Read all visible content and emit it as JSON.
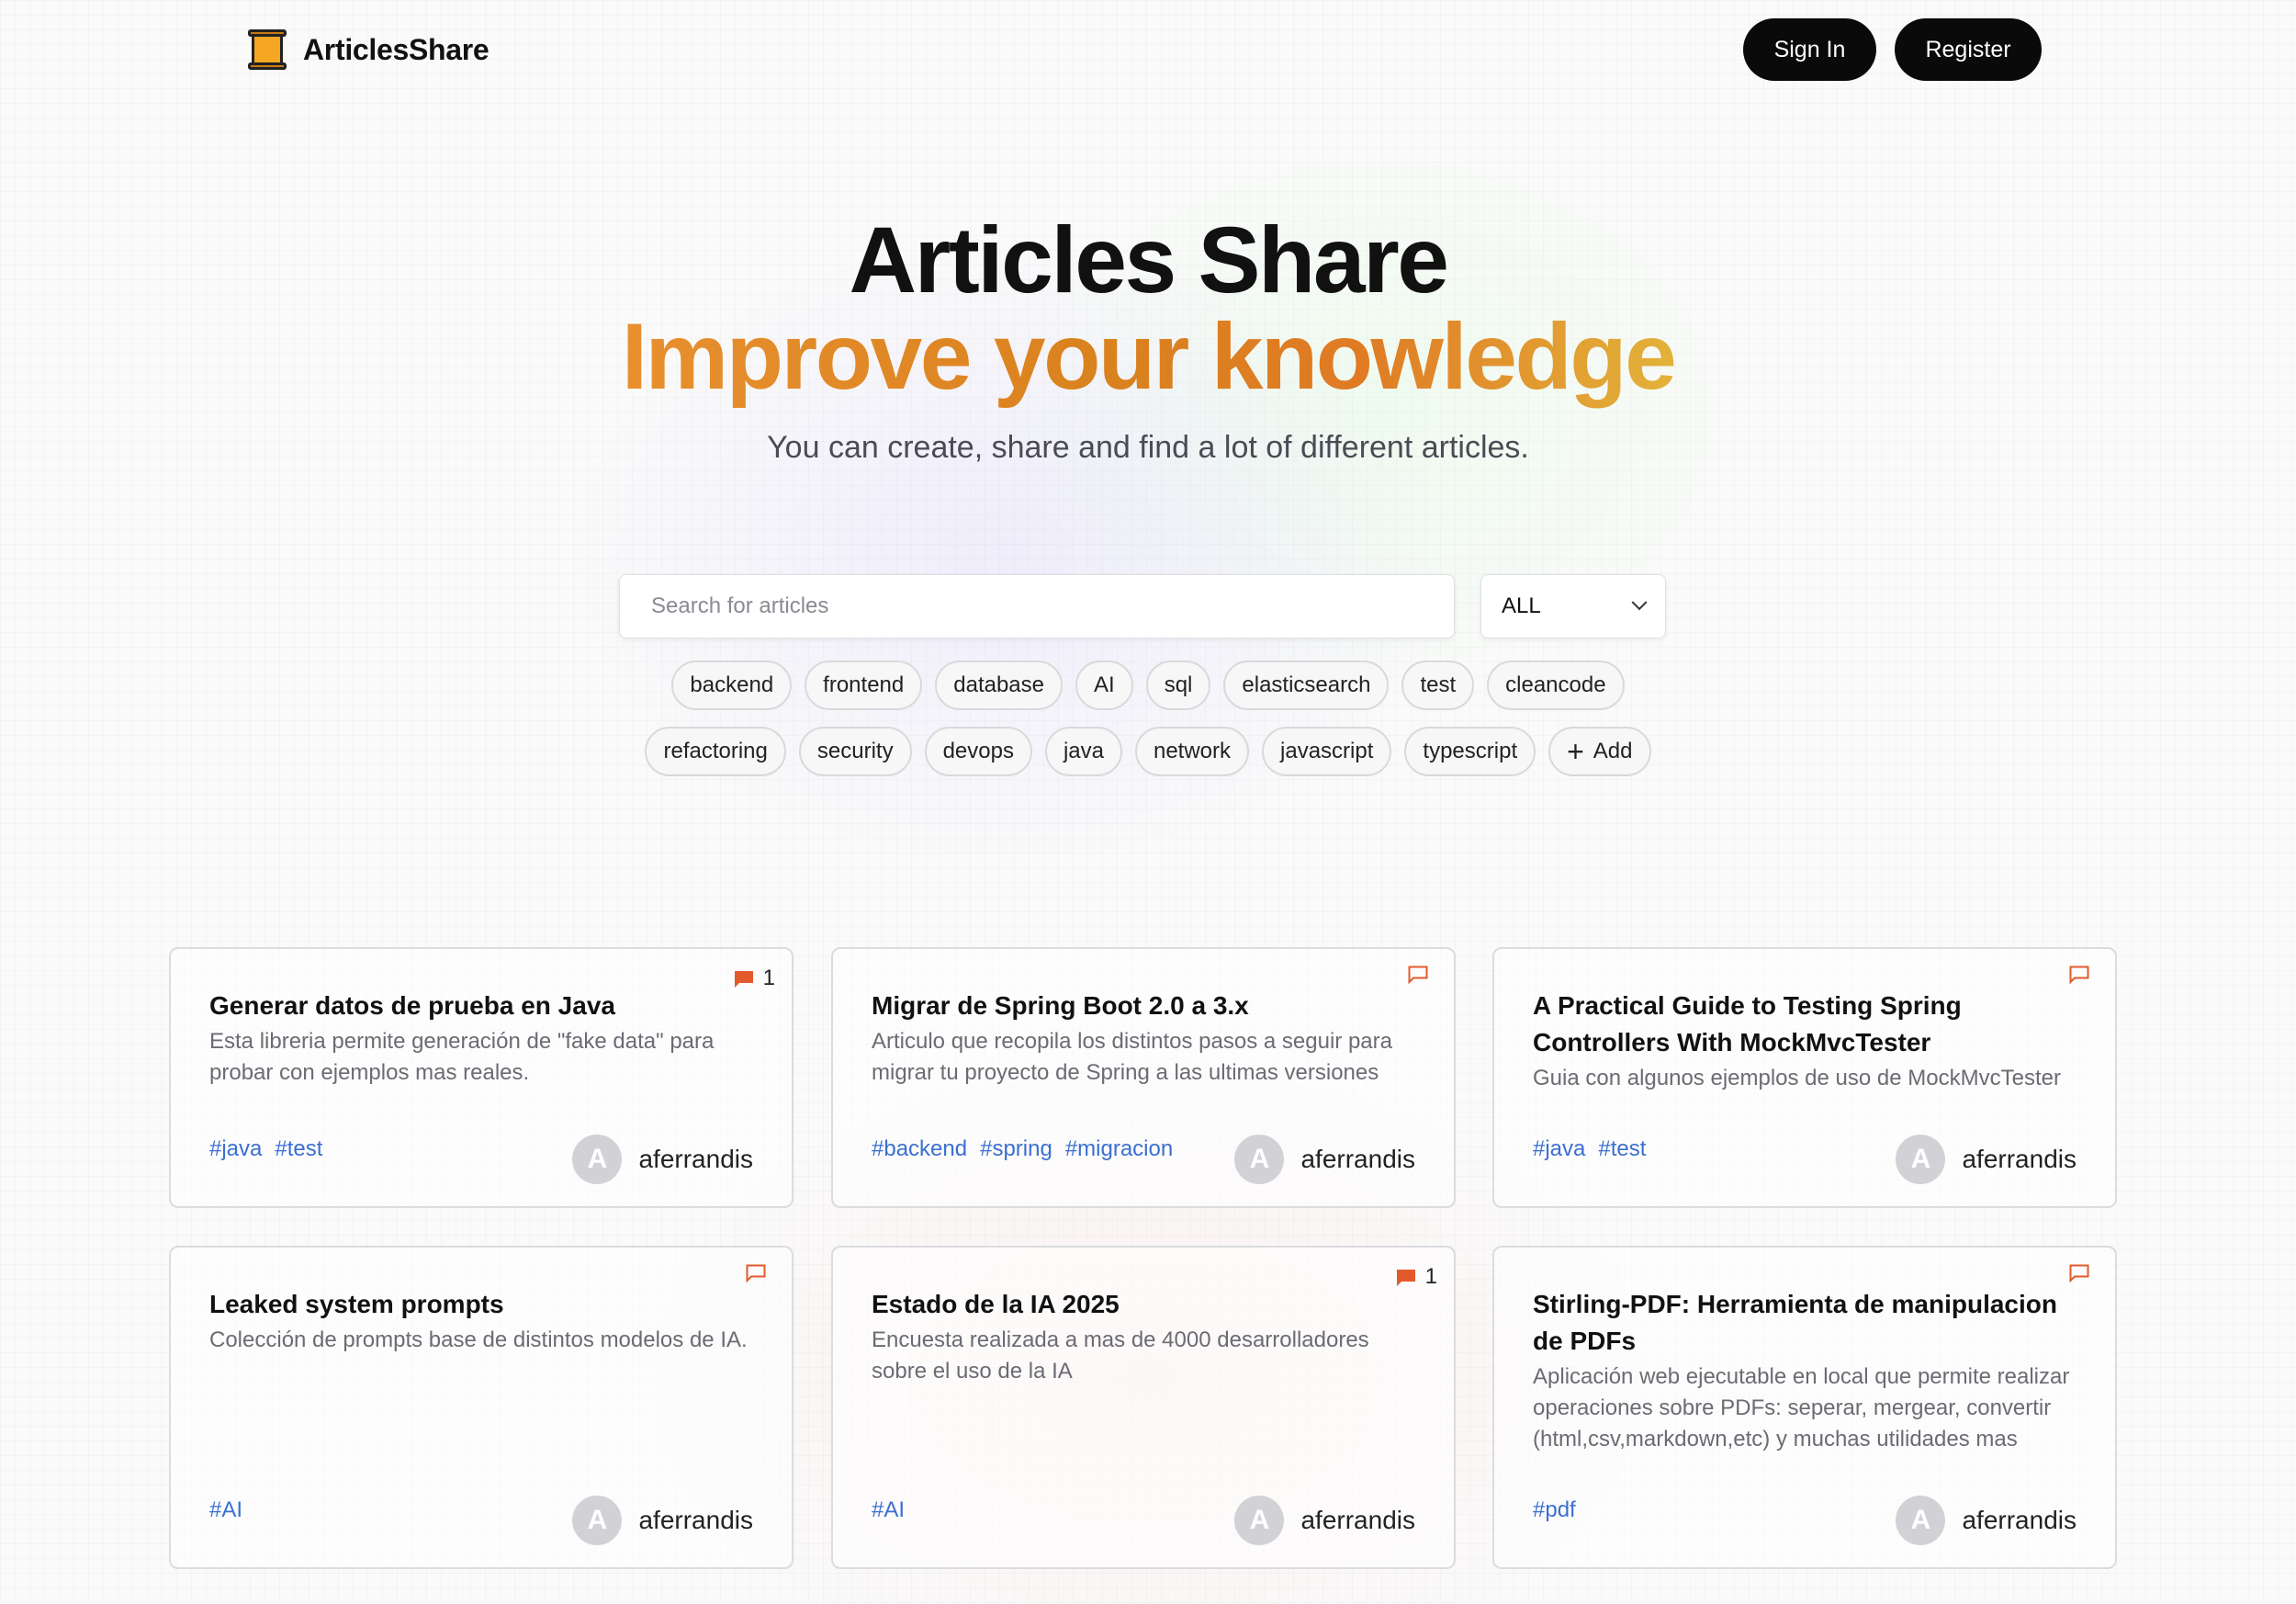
{
  "header": {
    "brand": "ArticlesShare",
    "sign_in": "Sign In",
    "register": "Register"
  },
  "hero": {
    "title": "Articles Share",
    "subtitle": "Improve your knowledge",
    "description": "You can create, share and find a lot of different articles."
  },
  "search": {
    "placeholder": "Search for articles",
    "filter_selected": "ALL"
  },
  "tags": {
    "row1": [
      "backend",
      "frontend",
      "database",
      "AI",
      "sql",
      "elasticsearch",
      "test",
      "cleancode"
    ],
    "row2": [
      "refactoring",
      "security",
      "devops",
      "java",
      "network",
      "javascript",
      "typescript"
    ],
    "add_label": "Add"
  },
  "articles": [
    {
      "title": "Generar datos de prueba en Java",
      "description": "Esta libreria permite generación de \"fake data\" para probar con ejemplos mas reales.",
      "tags": [
        "#java",
        "#test"
      ],
      "author": "aferrandis",
      "avatar_letter": "A",
      "comments": "1"
    },
    {
      "title": "Migrar de Spring Boot 2.0 a 3.x",
      "description": "Articulo que recopila los distintos pasos a seguir para migrar tu proyecto de Spring a las ultimas versiones",
      "tags": [
        "#backend",
        "#spring",
        "#migracion"
      ],
      "author": "aferrandis",
      "avatar_letter": "A",
      "comments": ""
    },
    {
      "title": "A Practical Guide to Testing Spring Controllers With MockMvcTester",
      "description": "Guia con algunos ejemplos de uso de MockMvcTester",
      "tags": [
        "#java",
        "#test"
      ],
      "author": "aferrandis",
      "avatar_letter": "A",
      "comments": ""
    },
    {
      "title": "Leaked system prompts",
      "description": "Colección de prompts base de distintos modelos de IA.",
      "tags": [
        "#AI"
      ],
      "author": "aferrandis",
      "avatar_letter": "A",
      "comments": ""
    },
    {
      "title": "Estado de la IA 2025",
      "description": "Encuesta realizada a mas de 4000 desarrolladores sobre el uso de la IA",
      "tags": [
        "#AI"
      ],
      "author": "aferrandis",
      "avatar_letter": "A",
      "comments": "1"
    },
    {
      "title": "Stirling-PDF: Herramienta de manipulacion de PDFs",
      "description": "Aplicación web ejecutable en local que permite realizar operaciones sobre PDFs: seperar, mergear, convertir (html,csv,markdown,etc) y muchas utilidades mas",
      "tags": [
        "#pdf"
      ],
      "author": "aferrandis",
      "avatar_letter": "A",
      "comments": ""
    }
  ],
  "colors": {
    "accent_orange": "#e8902f",
    "comment_icon": "#e25a2c",
    "tag_link": "#3b6fd1"
  }
}
